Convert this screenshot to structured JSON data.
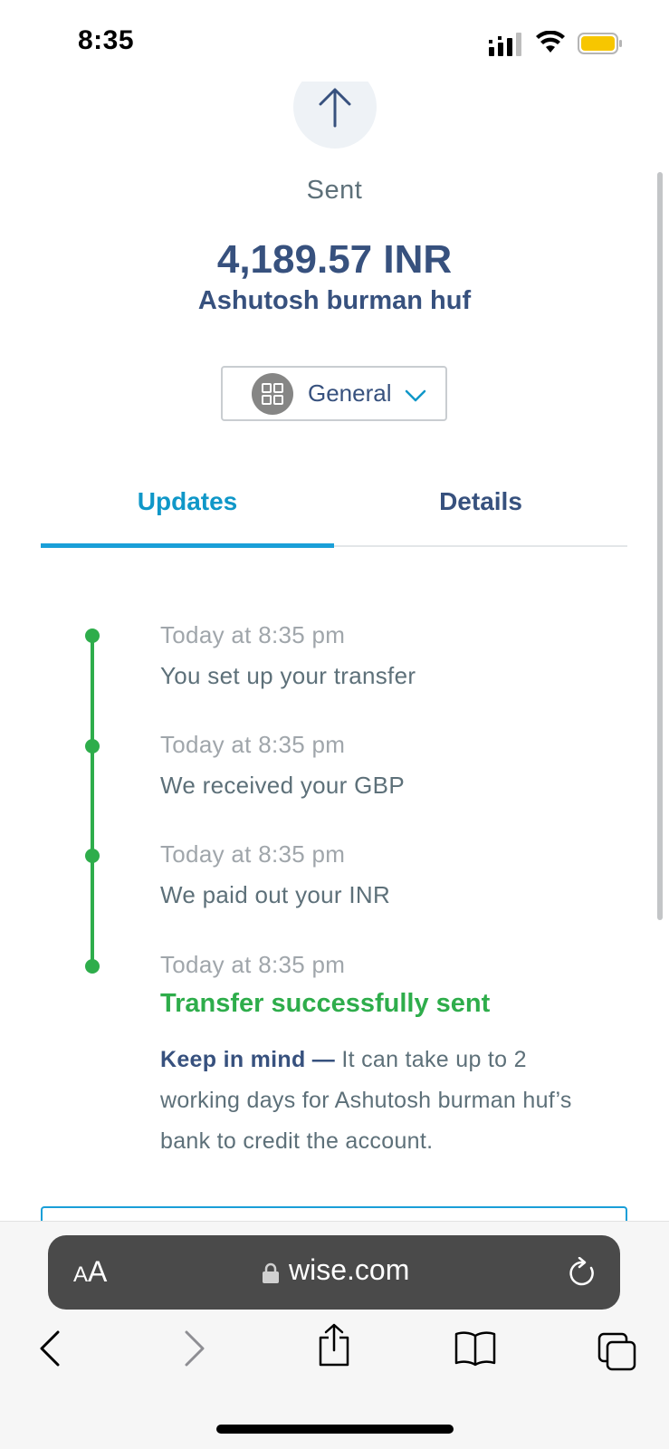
{
  "status_bar": {
    "time": "8:35"
  },
  "header": {
    "status": "Sent",
    "amount": "4,189.57 INR",
    "recipient": "Ashutosh burman huf"
  },
  "category": {
    "label": "General"
  },
  "tabs": [
    {
      "label": "Updates",
      "active": true
    },
    {
      "label": "Details",
      "active": false
    }
  ],
  "timeline": [
    {
      "time": "Today at 8:35 pm",
      "text": "You set up your transfer"
    },
    {
      "time": "Today at 8:35 pm",
      "text": "We received your GBP"
    },
    {
      "time": "Today at 8:35 pm",
      "text": "We paid out your INR"
    },
    {
      "time": "Today at 8:35 pm",
      "text": "Transfer successfully sent"
    }
  ],
  "note": {
    "strong": "Keep in mind —",
    "text": " It can take up to 2 working days for Ashutosh burman huf’s bank to credit the account."
  },
  "browser": {
    "text_size_small": "A",
    "text_size_big": "A",
    "url": "wise.com"
  },
  "colors": {
    "primary": "#37517e",
    "accent": "#1a9fd8",
    "success": "#2ead4b",
    "muted": "#5d7079"
  }
}
